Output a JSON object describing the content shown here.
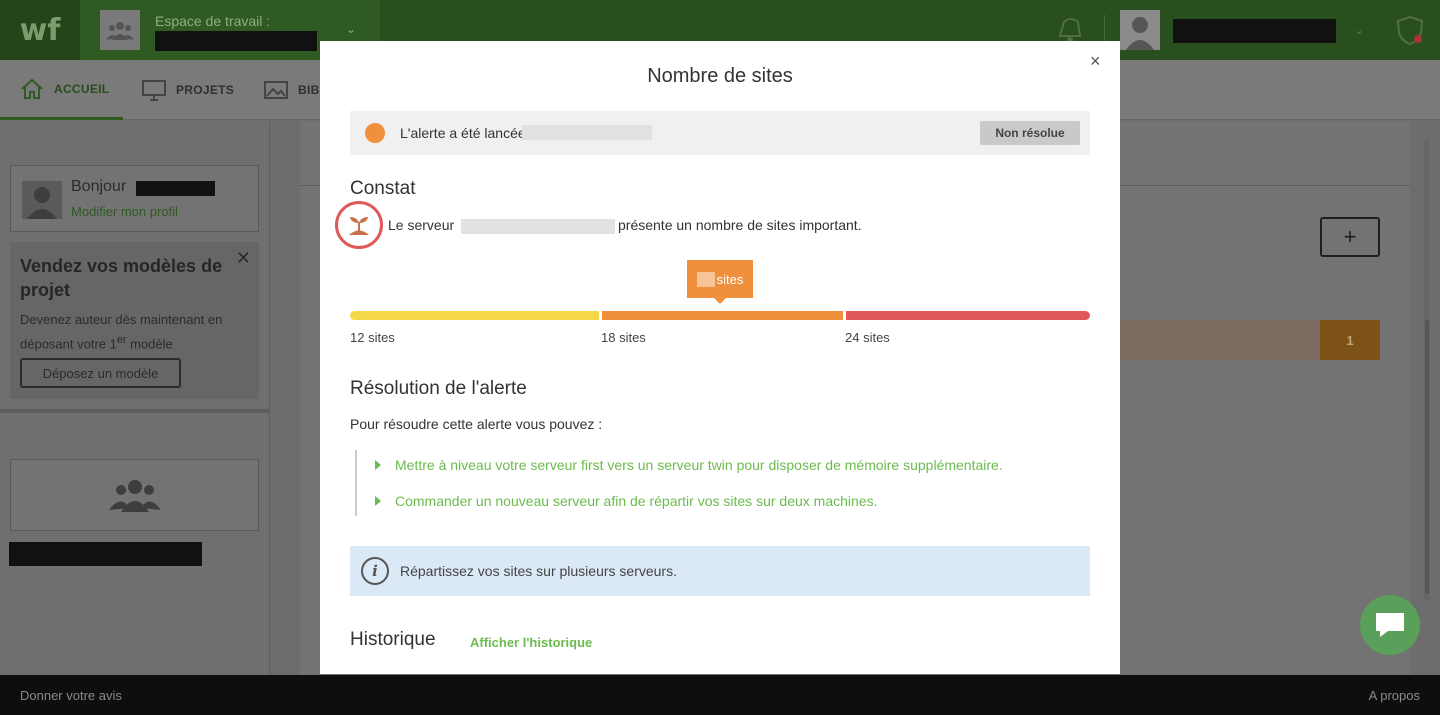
{
  "topbar": {
    "logo": "wf",
    "workspace_label": "Espace de travail :"
  },
  "nav": {
    "items": [
      {
        "label": "ACCUEIL",
        "icon": "home-icon",
        "active": true
      },
      {
        "label": "PROJETS",
        "icon": "monitor-icon",
        "active": false
      },
      {
        "label": "BIB",
        "icon": "image-icon",
        "active": false
      }
    ]
  },
  "sidebar": {
    "hello": "Bonjour",
    "edit_profile": "Modifier mon profil",
    "promo_title": "Vendez vos modèles de projet",
    "promo_text_a": "Devenez auteur dès maintenant en déposant votre 1",
    "promo_text_sup": "er",
    "promo_text_b": " modèle",
    "promo_button": "Déposez un modèle"
  },
  "main": {
    "plus_label": "+",
    "badge_count": "1"
  },
  "footer": {
    "left": "Donner votre avis",
    "right": "A propos"
  },
  "modal": {
    "title": "Nombre de sites",
    "close": "×",
    "alert_text": "L'alerte a été lancée",
    "status": "Non résolue",
    "constat_heading": "Constat",
    "constat_text_a": "Le serveur",
    "constat_text_b": "présente un nombre de sites important.",
    "gauge": {
      "tip_unit": "sites",
      "labels": [
        "12 sites",
        "18 sites",
        "24 sites"
      ],
      "colors": [
        "#f5d84a",
        "#f0903c",
        "#e05858"
      ]
    },
    "resolution_heading": "Résolution de l'alerte",
    "resolution_intro": "Pour résoudre cette alerte vous pouvez :",
    "resolution_items": [
      "Mettre à niveau votre serveur first vers un serveur twin pour disposer de mémoire supplémentaire.",
      "Commander un nouveau serveur afin de répartir vos sites sur deux machines."
    ],
    "info_icon": "i",
    "info_text": "Répartissez vos sites sur plusieurs serveurs.",
    "history_heading": "Historique",
    "history_link": "Afficher l'historique"
  },
  "colors": {
    "brand_green": "#6cbb4e",
    "alert_orange": "#f0903c",
    "danger_red": "#e05858",
    "info_blue": "#dbe9f6"
  }
}
